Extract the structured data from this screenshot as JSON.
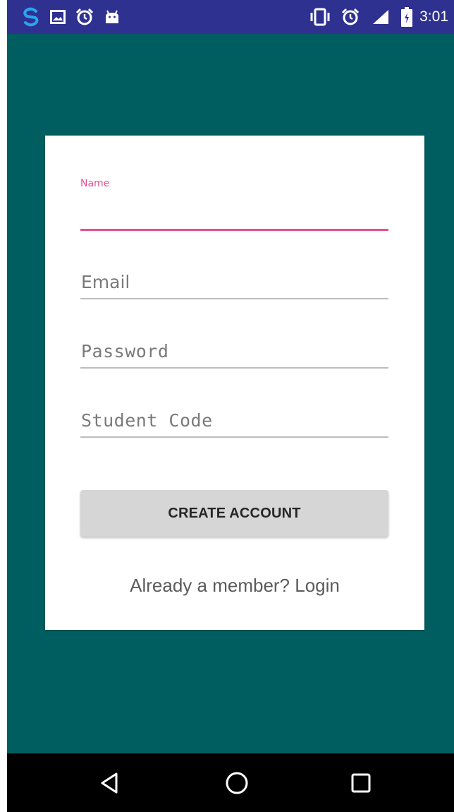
{
  "status_bar": {
    "time": "3:01",
    "left_icons": [
      "sync-icon",
      "image-icon",
      "alarm-icon",
      "android-icon"
    ],
    "right_icons": [
      "vibrate-icon",
      "alarm-icon",
      "signal-icon",
      "battery-icon"
    ]
  },
  "form": {
    "name": {
      "label": "Name",
      "value": ""
    },
    "email": {
      "placeholder": "Email",
      "value": ""
    },
    "password": {
      "placeholder": "Password",
      "value": ""
    },
    "student_code": {
      "placeholder": "Student Code",
      "value": ""
    },
    "create_button": "CREATE ACCOUNT",
    "login_link": "Already a member? Login"
  },
  "nav_bar": {
    "icons": [
      "back-icon",
      "home-icon",
      "recents-icon"
    ]
  },
  "colors": {
    "status_bar": "#2f3190",
    "background": "#015e60",
    "accent": "#e3508f",
    "card": "#ffffff",
    "button": "#d6d6d6"
  }
}
